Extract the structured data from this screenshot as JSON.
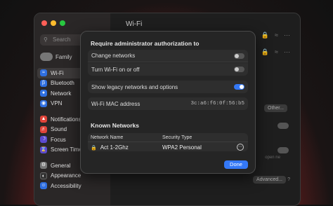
{
  "window": {
    "title": "Wi-Fi"
  },
  "sidebar": {
    "search_placeholder": "Search",
    "family_label": "Family",
    "items": [
      {
        "label": "Wi-Fi",
        "icon": "wifi-icon",
        "color": "#2f6fe0"
      },
      {
        "label": "Bluetooth",
        "icon": "bluetooth-icon",
        "color": "#2f6fe0"
      },
      {
        "label": "Network",
        "icon": "globe-icon",
        "color": "#2f6fe0"
      },
      {
        "label": "VPN",
        "icon": "vpn-icon",
        "color": "#2f6fe0"
      },
      {
        "label": "Notifications",
        "icon": "bell-icon",
        "color": "#e0443a"
      },
      {
        "label": "Sound",
        "icon": "speaker-icon",
        "color": "#e0443a"
      },
      {
        "label": "Focus",
        "icon": "moon-icon",
        "color": "#5b4ad0"
      },
      {
        "label": "Screen Time",
        "icon": "hourglass-icon",
        "color": "#5b4ad0"
      },
      {
        "label": "General",
        "icon": "gear-icon",
        "color": "#777777"
      },
      {
        "label": "Appearance",
        "icon": "appearance-icon",
        "color": "#333333"
      },
      {
        "label": "Accessibility",
        "icon": "accessibility-icon",
        "color": "#2f6fe0"
      }
    ]
  },
  "background": {
    "other_button": "Other...",
    "advanced_button": "Advanced...",
    "partial_text": "open ne"
  },
  "dialog": {
    "section_title": "Require administrator authorization to",
    "change_networks": "Change networks",
    "turn_wifi": "Turn Wi-Fi on or off",
    "legacy": "Show legacy networks and options",
    "mac_label": "Wi-Fi MAC address",
    "mac_value": "3c:a6:f6:0f:56:b5",
    "known_title": "Known Networks",
    "col_name": "Network Name",
    "col_security": "Security Type",
    "network_name": "Act 1-2Ghz",
    "network_security": "WPA2 Personal",
    "done_button": "Done",
    "toggles": {
      "change_networks": false,
      "turn_wifi": false,
      "legacy": true
    }
  }
}
